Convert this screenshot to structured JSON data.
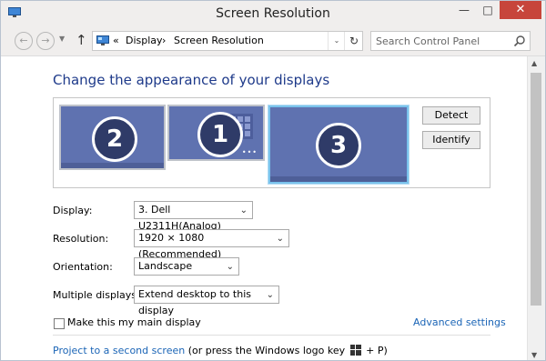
{
  "window": {
    "title": "Screen Resolution",
    "minimize_glyph": "—",
    "maximize_glyph": "□",
    "close_glyph": "✕"
  },
  "nav": {
    "back_glyph": "←",
    "forward_glyph": "→",
    "recent_glyph": "▼",
    "up_glyph": "↑",
    "breadcrumb": [
      "«",
      "Display",
      "›",
      "Screen Resolution"
    ],
    "dropdown_glyph": "⌄",
    "refresh_glyph": "↻",
    "search_placeholder": "Search Control Panel"
  },
  "main": {
    "heading": "Change the appearance of your displays",
    "monitors": [
      {
        "number": "2",
        "selected": false
      },
      {
        "number": "1",
        "selected": false
      },
      {
        "number": "3",
        "selected": true
      }
    ],
    "detect_label": "Detect",
    "identify_label": "Identify"
  },
  "settings": {
    "display_label": "Display:",
    "display_value": "3. Dell U2311H(Analog)",
    "resolution_label": "Resolution:",
    "resolution_value": "1920 × 1080 (Recommended)",
    "orientation_label": "Orientation:",
    "orientation_value": "Landscape",
    "multiple_label": "Multiple displays:",
    "multiple_value": "Extend desktop to this display",
    "select_arrow": "⌄"
  },
  "footer": {
    "main_display_label": "Make this my main display",
    "main_display_checked": false,
    "advanced_link": "Advanced settings",
    "project_link": "Project to a second screen",
    "project_suffix_a": "(or press the Windows logo key",
    "project_suffix_b": "+ P)"
  },
  "colors": {
    "heading": "#1e3a8a",
    "link": "#1a64b6",
    "monitor_fill": "#5f72b0",
    "monitor_selected_border": "#7ac3ec",
    "close_button": "#c7453b"
  }
}
